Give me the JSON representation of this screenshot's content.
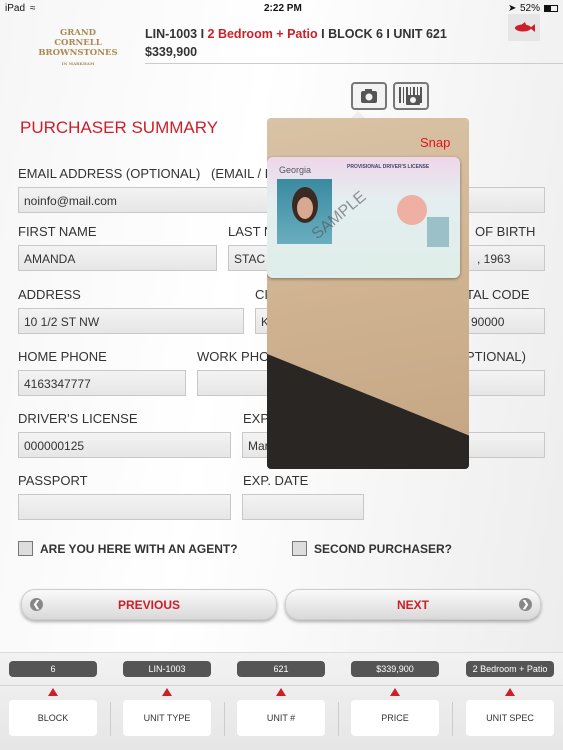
{
  "status_bar": {
    "device": "iPad",
    "time": "2:22 PM",
    "battery": "52%"
  },
  "header": {
    "logo": "GRAND CORNELL BROWNSTONES IN MARKHAM",
    "unit_code": "LIN-1003",
    "sep": " I ",
    "unit_spec": "2 Bedroom + Patio",
    "block_unit": "BLOCK 6 I UNIT 621",
    "price": "$339,900"
  },
  "title": "PURCHASER SUMMARY",
  "camera": {
    "snap_label": "Snap"
  },
  "form": {
    "email_label": "EMAIL ADDRESS (OPTIONAL)",
    "email_confirm_label": "(EMAIL / F",
    "email_value": "noinfo@mail.com",
    "first_name_label": "FIRST NAME",
    "first_name_value": "AMANDA",
    "last_name_label": "LAST N",
    "last_name_value": "STAC",
    "dob_label": "OF BIRTH",
    "dob_value": ", 1963",
    "address_label": "ADDRESS",
    "address_value": "10 1/2 ST NW",
    "city_label": "CI",
    "city_value": "K",
    "postal_label": "TAL CODE",
    "postal_value": "90000",
    "home_phone_label": "HOME PHONE",
    "home_phone_value": "4163347777",
    "work_phone_label": "WORK PHO",
    "optional_label": "PTIONAL)",
    "license_label": "DRIVER'S LICENSE",
    "license_value": "000000125",
    "license_exp_label": "EXP",
    "license_exp_value": "Mar",
    "passport_label": "PASSPORT",
    "passport_value": "",
    "passport_exp_label": "EXP. DATE",
    "passport_exp_value": "",
    "agent_label": "ARE YOU HERE WITH AN AGENT?",
    "agent_checked": false,
    "second_label": "SECOND PURCHASER?",
    "second_checked": false
  },
  "nav": {
    "previous": "PREVIOUS",
    "next": "NEXT"
  },
  "bottom": [
    {
      "value": "6",
      "label": "BLOCK"
    },
    {
      "value": "LIN-1003",
      "label": "UNIT TYPE"
    },
    {
      "value": "621",
      "label": "UNIT #"
    },
    {
      "value": "$339,900",
      "label": "PRICE"
    },
    {
      "value": "2 Bedroom + Patio",
      "label": "UNIT SPEC"
    }
  ],
  "colors": {
    "accent": "#cc1f2a",
    "logo": "#a88a55"
  }
}
